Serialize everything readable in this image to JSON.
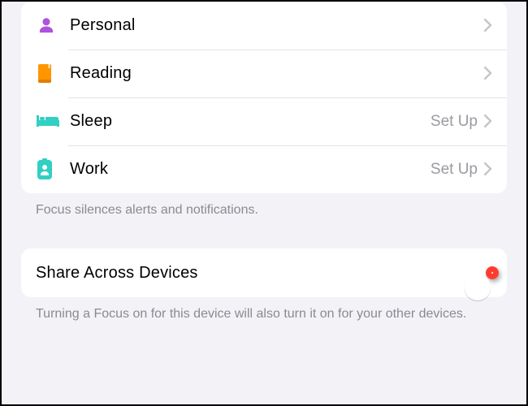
{
  "focus_list": {
    "items": [
      {
        "key": "personal",
        "label": "Personal",
        "status": "",
        "color": "#af52de",
        "icon": "person"
      },
      {
        "key": "reading",
        "label": "Reading",
        "status": "",
        "color": "#ff9500",
        "icon": "book"
      },
      {
        "key": "sleep",
        "label": "Sleep",
        "status": "Set Up",
        "color": "#30d0c3",
        "icon": "bed"
      },
      {
        "key": "work",
        "label": "Work",
        "status": "Set Up",
        "color": "#30d0c3",
        "icon": "badge"
      }
    ],
    "footer": "Focus silences alerts and notifications."
  },
  "share": {
    "label": "Share Across Devices",
    "on": true,
    "footer": "Turning a Focus on for this device will also turn it on for your other devices."
  },
  "colors": {
    "toggle_on": "#34c759",
    "highlight": "#ff3b30"
  }
}
